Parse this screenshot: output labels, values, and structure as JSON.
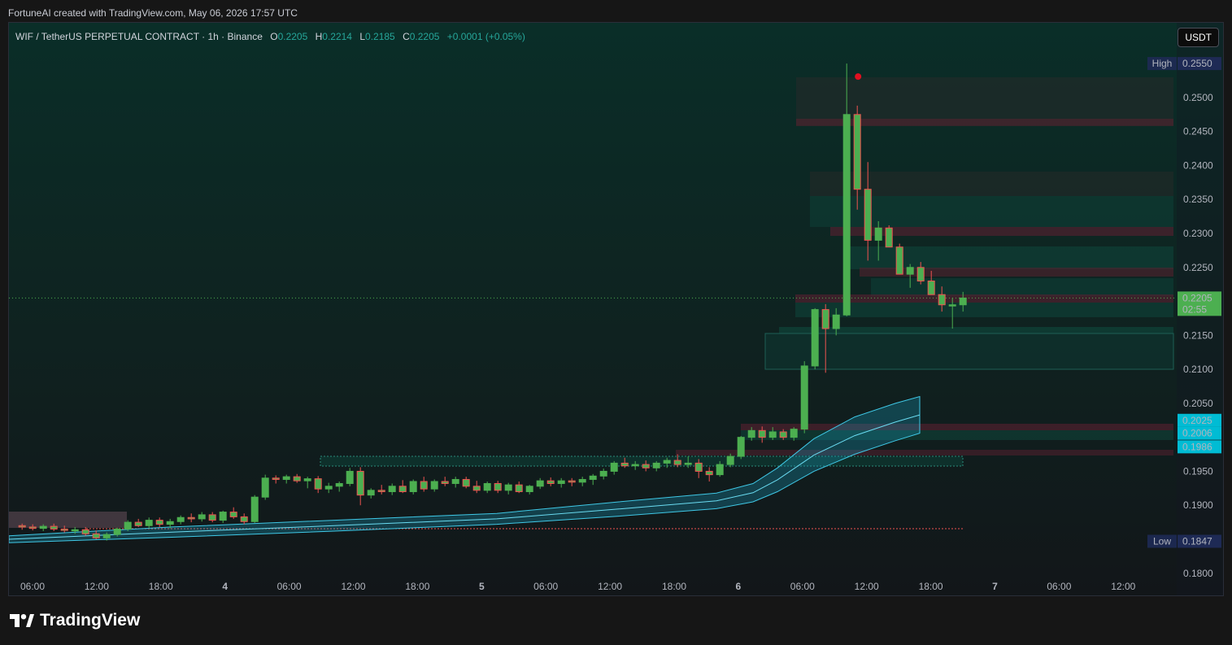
{
  "header": {
    "attribution": "FortuneAI created with TradingView.com, May 06, 2026 17:57 UTC"
  },
  "legend": {
    "symbol": "WIF / TetherUS PERPETUAL CONTRACT · 1h · Binance",
    "o_label": "O",
    "o_value": "0.2205",
    "h_label": "H",
    "h_value": "0.2214",
    "l_label": "L",
    "l_value": "0.2185",
    "c_label": "C",
    "c_value": "0.2205",
    "change": "+0.0001 (+0.05%)"
  },
  "currency_button": "USDT",
  "brand": "TradingView",
  "colors": {
    "up": "#4caf50",
    "down": "#ef5350",
    "accent": "#00bcd4",
    "background": "#0f2a26"
  },
  "chart_data": {
    "type": "candlestick",
    "y_ticks": [
      "0.2500",
      "0.2450",
      "0.2400",
      "0.2350",
      "0.2300",
      "0.2250",
      "0.2150",
      "0.2100",
      "0.2050",
      "0.1950",
      "0.1900",
      "0.1800"
    ],
    "x_ticks": [
      "06:00",
      "12:00",
      "18:00",
      "4",
      "06:00",
      "12:00",
      "18:00",
      "5",
      "06:00",
      "12:00",
      "18:00",
      "6",
      "06:00",
      "12:00",
      "18:00",
      "7",
      "06:00",
      "12:00"
    ],
    "ylim": [
      0.1765,
      0.261
    ],
    "high": {
      "label": "High",
      "value": "0.2550"
    },
    "low": {
      "label": "Low",
      "value": "0.1847"
    },
    "last_price": {
      "value": "0.2205",
      "countdown": "02:55"
    },
    "indicator_labels": [
      "0.2025",
      "0.2006",
      "0.1986"
    ],
    "candles_ohlc": [
      [
        0.187,
        0.1873,
        0.1864,
        0.1868
      ],
      [
        0.1868,
        0.1872,
        0.1863,
        0.1866
      ],
      [
        0.1866,
        0.1872,
        0.1862,
        0.1869
      ],
      [
        0.1869,
        0.1873,
        0.1862,
        0.1865
      ],
      [
        0.1865,
        0.187,
        0.186,
        0.1863
      ],
      [
        0.1863,
        0.1868,
        0.1858,
        0.1864
      ],
      [
        0.1864,
        0.1868,
        0.1855,
        0.1858
      ],
      [
        0.1858,
        0.1863,
        0.185,
        0.1852
      ],
      [
        0.1852,
        0.186,
        0.1848,
        0.1857
      ],
      [
        0.1857,
        0.1867,
        0.1854,
        0.1865
      ],
      [
        0.1865,
        0.1878,
        0.1862,
        0.1875
      ],
      [
        0.1875,
        0.188,
        0.1868,
        0.187
      ],
      [
        0.187,
        0.1882,
        0.1866,
        0.1878
      ],
      [
        0.1878,
        0.1882,
        0.1868,
        0.1872
      ],
      [
        0.1872,
        0.188,
        0.1866,
        0.1876
      ],
      [
        0.1876,
        0.1885,
        0.1872,
        0.1882
      ],
      [
        0.1882,
        0.1888,
        0.1875,
        0.188
      ],
      [
        0.188,
        0.189,
        0.1876,
        0.1886
      ],
      [
        0.1886,
        0.189,
        0.1875,
        0.1878
      ],
      [
        0.1878,
        0.1892,
        0.1874,
        0.189
      ],
      [
        0.189,
        0.1897,
        0.188,
        0.1883
      ],
      [
        0.1883,
        0.1888,
        0.1872,
        0.1876
      ],
      [
        0.1876,
        0.1915,
        0.1874,
        0.1912
      ],
      [
        0.1912,
        0.1945,
        0.1908,
        0.194
      ],
      [
        0.194,
        0.1944,
        0.1932,
        0.1938
      ],
      [
        0.1938,
        0.1945,
        0.1932,
        0.1942
      ],
      [
        0.1942,
        0.1946,
        0.1933,
        0.1936
      ],
      [
        0.1936,
        0.1942,
        0.1925,
        0.1939
      ],
      [
        0.1939,
        0.1943,
        0.1918,
        0.1924
      ],
      [
        0.1924,
        0.1933,
        0.1918,
        0.1928
      ],
      [
        0.1928,
        0.1935,
        0.192,
        0.1932
      ],
      [
        0.1932,
        0.1955,
        0.1928,
        0.195
      ],
      [
        0.195,
        0.1956,
        0.19,
        0.1915
      ],
      [
        0.1915,
        0.1925,
        0.191,
        0.1922
      ],
      [
        0.1922,
        0.193,
        0.1916,
        0.192
      ],
      [
        0.192,
        0.1932,
        0.1915,
        0.1928
      ],
      [
        0.1928,
        0.1937,
        0.1918,
        0.192
      ],
      [
        0.192,
        0.1938,
        0.1916,
        0.1935
      ],
      [
        0.1935,
        0.1942,
        0.192,
        0.1924
      ],
      [
        0.1924,
        0.1938,
        0.192,
        0.1935
      ],
      [
        0.1935,
        0.1942,
        0.1928,
        0.1932
      ],
      [
        0.1932,
        0.1942,
        0.1926,
        0.1938
      ],
      [
        0.1938,
        0.1942,
        0.1925,
        0.1928
      ],
      [
        0.1928,
        0.1936,
        0.1918,
        0.1922
      ],
      [
        0.1922,
        0.1935,
        0.1918,
        0.1932
      ],
      [
        0.1932,
        0.1936,
        0.1918,
        0.1922
      ],
      [
        0.1922,
        0.1933,
        0.1916,
        0.193
      ],
      [
        0.193,
        0.1935,
        0.1918,
        0.192
      ],
      [
        0.192,
        0.193,
        0.1916,
        0.1928
      ],
      [
        0.1928,
        0.194,
        0.1924,
        0.1936
      ],
      [
        0.1936,
        0.1941,
        0.1928,
        0.1932
      ],
      [
        0.1932,
        0.194,
        0.1926,
        0.1936
      ],
      [
        0.1936,
        0.194,
        0.1928,
        0.1934
      ],
      [
        0.1934,
        0.1942,
        0.1928,
        0.1938
      ],
      [
        0.1938,
        0.1946,
        0.193,
        0.1943
      ],
      [
        0.1943,
        0.1954,
        0.1938,
        0.195
      ],
      [
        0.195,
        0.1965,
        0.1945,
        0.1962
      ],
      [
        0.1962,
        0.197,
        0.1955,
        0.1958
      ],
      [
        0.1958,
        0.1965,
        0.1952,
        0.196
      ],
      [
        0.196,
        0.1966,
        0.195,
        0.1955
      ],
      [
        0.1955,
        0.1965,
        0.195,
        0.1962
      ],
      [
        0.1962,
        0.197,
        0.1955,
        0.1966
      ],
      [
        0.1966,
        0.1975,
        0.1956,
        0.196
      ],
      [
        0.196,
        0.1972,
        0.1955,
        0.1962
      ],
      [
        0.1962,
        0.1968,
        0.194,
        0.195
      ],
      [
        0.195,
        0.1956,
        0.1935,
        0.1945
      ],
      [
        0.1945,
        0.1965,
        0.1942,
        0.196
      ],
      [
        0.196,
        0.1976,
        0.1956,
        0.1972
      ],
      [
        0.1972,
        0.2002,
        0.1968,
        0.2
      ],
      [
        0.2,
        0.2015,
        0.1995,
        0.201
      ],
      [
        0.201,
        0.2016,
        0.1992,
        0.2
      ],
      [
        0.2,
        0.2015,
        0.1996,
        0.2008
      ],
      [
        0.2008,
        0.2012,
        0.1996,
        0.2
      ],
      [
        0.2,
        0.2015,
        0.1995,
        0.2012
      ],
      [
        0.2012,
        0.2112,
        0.2006,
        0.2105
      ],
      [
        0.2105,
        0.219,
        0.21,
        0.2188
      ],
      [
        0.2188,
        0.2196,
        0.2095,
        0.216
      ],
      [
        0.216,
        0.219,
        0.215,
        0.218
      ],
      [
        0.218,
        0.255,
        0.2178,
        0.2475
      ],
      [
        0.2475,
        0.2488,
        0.2335,
        0.2365
      ],
      [
        0.2365,
        0.2405,
        0.226,
        0.229
      ],
      [
        0.229,
        0.2318,
        0.226,
        0.2308
      ],
      [
        0.2308,
        0.2312,
        0.2282,
        0.228
      ],
      [
        0.228,
        0.2285,
        0.224,
        0.224
      ],
      [
        0.224,
        0.2255,
        0.222,
        0.225
      ],
      [
        0.225,
        0.2258,
        0.2225,
        0.223
      ],
      [
        0.223,
        0.2245,
        0.221,
        0.221
      ],
      [
        0.221,
        0.2222,
        0.2185,
        0.2195
      ],
      [
        0.2195,
        0.2205,
        0.216,
        0.2195
      ],
      [
        0.2195,
        0.2214,
        0.2185,
        0.2205
      ]
    ]
  }
}
